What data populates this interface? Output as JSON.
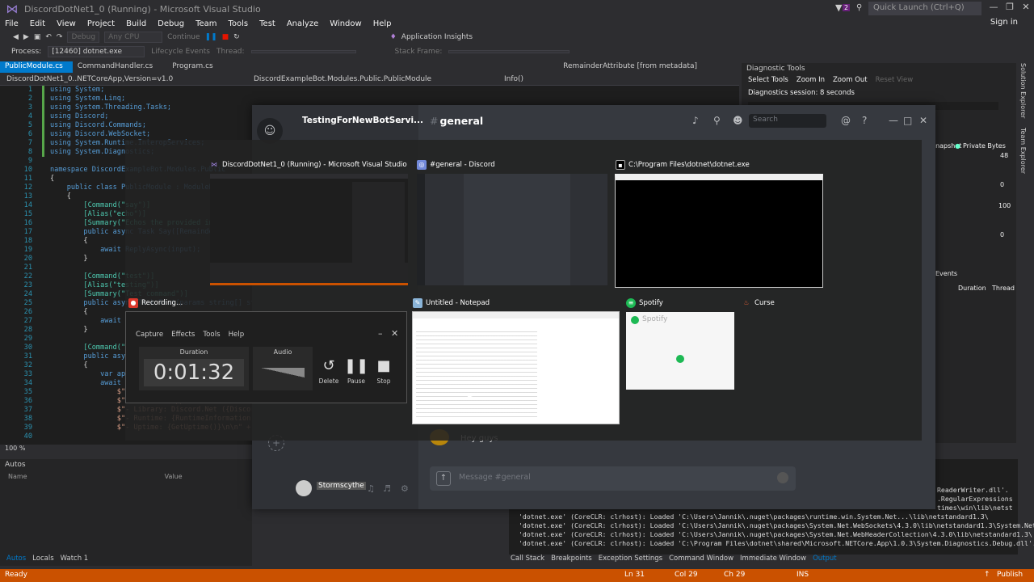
{
  "vs": {
    "title": "DiscordDotNet1_0 (Running) - Microsoft Visual Studio",
    "quick_launch": "Quick Launch (Ctrl+Q)",
    "filter_count": "2",
    "menu": [
      "File",
      "Edit",
      "View",
      "Project",
      "Build",
      "Debug",
      "Team",
      "Tools",
      "Test",
      "Analyze",
      "Window",
      "Help"
    ],
    "sign_in": "Sign in",
    "toolbar": {
      "config": "Debug",
      "platform": "Any CPU",
      "continue": "Continue",
      "app_insights": "Application Insights",
      "lifecycle": "Lifecycle Events",
      "thread": "Thread:",
      "stack_frame": "Stack Frame:"
    },
    "process": {
      "label": "Process:",
      "value": "[12460] dotnet.exe"
    },
    "tabs": [
      "PublicModule.cs",
      "CommandHandler.cs",
      "Program.cs"
    ],
    "tab_right": "RemainderAttribute [from metadata]",
    "crumbs": {
      "project": "DiscordDotNet1_0..NETCoreApp,Version=v1.0",
      "class": "DiscordExampleBot.Modules.Public.PublicModule",
      "member": "Info()"
    },
    "code": [
      {
        "n": "1",
        "t": "using System;"
      },
      {
        "n": "2",
        "t": "using System.Linq;"
      },
      {
        "n": "3",
        "t": "using System.Threading.Tasks;"
      },
      {
        "n": "4",
        "t": "using Discord;"
      },
      {
        "n": "5",
        "t": "using Discord.Commands;"
      },
      {
        "n": "6",
        "t": "using Discord.WebSocket;"
      },
      {
        "n": "7",
        "t": "using System.Runtime.InteropServices;"
      },
      {
        "n": "8",
        "t": "using System.Diagnostics;"
      },
      {
        "n": "9",
        "t": ""
      },
      {
        "n": "10",
        "t": "namespace DiscordExampleBot.Modules.Public"
      },
      {
        "n": "11",
        "t": "{"
      },
      {
        "n": "12",
        "t": "    public class PublicModule : ModuleBase"
      },
      {
        "n": "13",
        "t": "    {"
      },
      {
        "n": "14",
        "t": "        [Command(\"say\")]"
      },
      {
        "n": "15",
        "t": "        [Alias(\"echo\")]"
      },
      {
        "n": "16",
        "t": "        [Summary(\"Echos the provided input\")]"
      },
      {
        "n": "17",
        "t": "        public async Task Say([Remainder]"
      },
      {
        "n": "18",
        "t": "        {"
      },
      {
        "n": "19",
        "t": "            await ReplyAsync(input);"
      },
      {
        "n": "20",
        "t": "        }"
      },
      {
        "n": "21",
        "t": ""
      },
      {
        "n": "22",
        "t": "        [Command(\"test\")]"
      },
      {
        "n": "23",
        "t": "        [Alias(\"testing\")]"
      },
      {
        "n": "24",
        "t": "        [Summary(\"Test command\")]"
      },
      {
        "n": "25",
        "t": "        public async Task Test(params string[] str)"
      },
      {
        "n": "26",
        "t": "        {"
      },
      {
        "n": "27",
        "t": "            await ReplyAsync(string.Join(\" \", str));"
      },
      {
        "n": "28",
        "t": "        }"
      },
      {
        "n": "29",
        "t": ""
      },
      {
        "n": "30",
        "t": "        [Command(\"info\")]"
      },
      {
        "n": "31",
        "t": "        public async Task Info()"
      },
      {
        "n": "32",
        "t": "        {"
      },
      {
        "n": "33",
        "t": "            var application ="
      },
      {
        "n": "34",
        "t": "            await ReplyAsync("
      },
      {
        "n": "35",
        "t": "                $\"{Format.Bold(\"Info\")}\\n\" +"
      },
      {
        "n": "36",
        "t": "                $\"- Author: {application.Owner.Username}\\n\" +"
      },
      {
        "n": "37",
        "t": "                $\"- Library: Discord.Net ({DiscordConfig.Version})\\n\" +"
      },
      {
        "n": "38",
        "t": "                $\"- Runtime: {RuntimeInformation.Fram\" +"
      },
      {
        "n": "39",
        "t": "                $\"- Uptime: {GetUptime()}\\n\\n\" +"
      },
      {
        "n": "40",
        "t": ""
      }
    ],
    "zoom": "100 %",
    "autos": {
      "title": "Autos",
      "col_name": "Name",
      "col_value": "Value"
    },
    "bottom_tabs_left": [
      "Autos",
      "Locals",
      "Watch 1"
    ],
    "diag": {
      "title": "Diagnostic Tools",
      "select_tools": "Select Tools",
      "zoom_in": "Zoom In",
      "zoom_out": "Zoom Out",
      "reset_view": "Reset View",
      "session": "Diagnostics session: 8 seconds",
      "snapshot": "Snapshot",
      "private_bytes": "Private Bytes",
      "y_48": "48",
      "y_0a": "0",
      "y_100": "100",
      "y_0b": "0",
      "events": "Events",
      "col_duration": "Duration",
      "col_thread": "Thread"
    },
    "side_tabs": [
      "Solution Explorer",
      "Team Explorer"
    ],
    "output_lines": [
      "ReaderWriter.dll'.",
      ".RegularExpressions",
      "times\\win\\lib\\netst",
      "'dotnet.exe' (CoreCLR: clrhost): Loaded 'C:\\Users\\Jannik\\.nuget\\packages\\runtime.win.System.Net...\\lib\\netstandard1.3\\",
      "'dotnet.exe' (CoreCLR: clrhost): Loaded 'C:\\Users\\Jannik\\.nuget\\packages\\System.Net.WebSockets\\4.3.0\\lib\\netstandard1.3\\System.Net",
      "'dotnet.exe' (CoreCLR: clrhost): Loaded 'C:\\Users\\Jannik\\.nuget\\packages\\System.Net.WebHeaderCollection\\4.3.0\\lib\\netstandard1.3\\",
      "'dotnet.exe' (CoreCLR: clrhost): Loaded 'C:\\Program Files\\dotnet\\shared\\Microsoft.NETCore.App\\1.0.3\\System.Diagnostics.Debug.dll'."
    ],
    "bottom_tabs_right": [
      "Call Stack",
      "Breakpoints",
      "Exception Settings",
      "Command Window",
      "Immediate Window",
      "Output"
    ],
    "status": {
      "ready": "Ready",
      "ln": "Ln 31",
      "col": "Col 29",
      "ch": "Ch 29",
      "ins": "INS",
      "publish": "Publish"
    }
  },
  "discord": {
    "server_name": "TestingForNewBotServi...",
    "channel": "general",
    "channel_hash": "#",
    "search": "Search",
    "message_placeholder": "Message #general",
    "last_message": "Hey guys",
    "username": "Stormscythe"
  },
  "switcher": {
    "windows": [
      {
        "title": "DiscordDotNet1_0 (Running) - Microsoft Visual Studio",
        "icon": "visual-studio-icon"
      },
      {
        "title": "#general - Discord",
        "icon": "discord-icon"
      },
      {
        "title": "C:\\Program Files\\dotnet\\dotnet.exe",
        "icon": "console-icon"
      },
      {
        "title": "Recording...",
        "icon": "recorder-icon"
      },
      {
        "title": "Untitled - Notepad",
        "icon": "notepad-icon"
      },
      {
        "title": "Spotify",
        "icon": "spotify-icon"
      },
      {
        "title": "Curse",
        "icon": "curse-icon"
      }
    ],
    "spotify_label": "Spotify"
  },
  "recorder": {
    "menu": [
      "Capture",
      "Effects",
      "Tools",
      "Help"
    ],
    "duration_label": "Duration",
    "duration": "0:01:32",
    "audio_label": "Audio",
    "delete": "Delete",
    "pause": "Pause",
    "stop": "Stop"
  },
  "colors": {
    "vs_accent": "#007acc",
    "status_bar": "#ca5100",
    "discord_bg": "#36393f",
    "spotify_green": "#1db954"
  }
}
